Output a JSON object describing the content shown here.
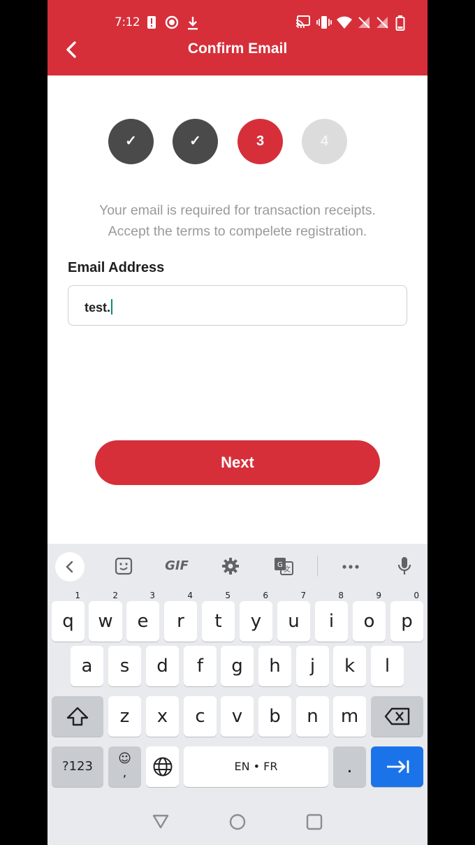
{
  "status_bar": {
    "time": "7:12",
    "left_icons": [
      "alert-icon",
      "record-icon",
      "download-icon"
    ],
    "right_icons": [
      "cast-icon",
      "vibrate-icon",
      "wifi-icon",
      "no-signal-icon",
      "no-signal-icon",
      "battery-icon"
    ]
  },
  "header": {
    "title": "Confirm Email",
    "back_icon": "chevron-left-icon"
  },
  "stepper": {
    "steps": [
      {
        "label": "✓",
        "state": "done"
      },
      {
        "label": "✓",
        "state": "done"
      },
      {
        "label": "3",
        "state": "active"
      },
      {
        "label": "4",
        "state": "todo"
      }
    ]
  },
  "description": {
    "line1": "Your email is required for transaction receipts.",
    "line2": "Accept the terms to compelete registration."
  },
  "form": {
    "email_label": "Email Address",
    "email_value": "test."
  },
  "next_button": {
    "label": "Next"
  },
  "keyboard": {
    "toolbar": [
      "chevron-left-icon",
      "sticker-icon",
      "GIF",
      "settings-icon",
      "translate-icon",
      "more-icon",
      "mic-icon"
    ],
    "row1": [
      [
        "q",
        "1"
      ],
      [
        "w",
        "2"
      ],
      [
        "e",
        "3"
      ],
      [
        "r",
        "4"
      ],
      [
        "t",
        "5"
      ],
      [
        "y",
        "6"
      ],
      [
        "u",
        "7"
      ],
      [
        "i",
        "8"
      ],
      [
        "o",
        "9"
      ],
      [
        "p",
        "0"
      ]
    ],
    "row2": [
      "a",
      "s",
      "d",
      "f",
      "g",
      "h",
      "j",
      "k",
      "l"
    ],
    "row3": [
      "z",
      "x",
      "c",
      "v",
      "b",
      "n",
      "m"
    ],
    "symbols_label": "?123",
    "emoji_comma": ",",
    "space_label": "EN • FR",
    "period": "."
  },
  "colors": {
    "brand_red": "#d62f3a",
    "step_done": "#4a4a4a",
    "step_todo": "#dcdcdc",
    "keyboard_enter": "#1a73e8"
  }
}
